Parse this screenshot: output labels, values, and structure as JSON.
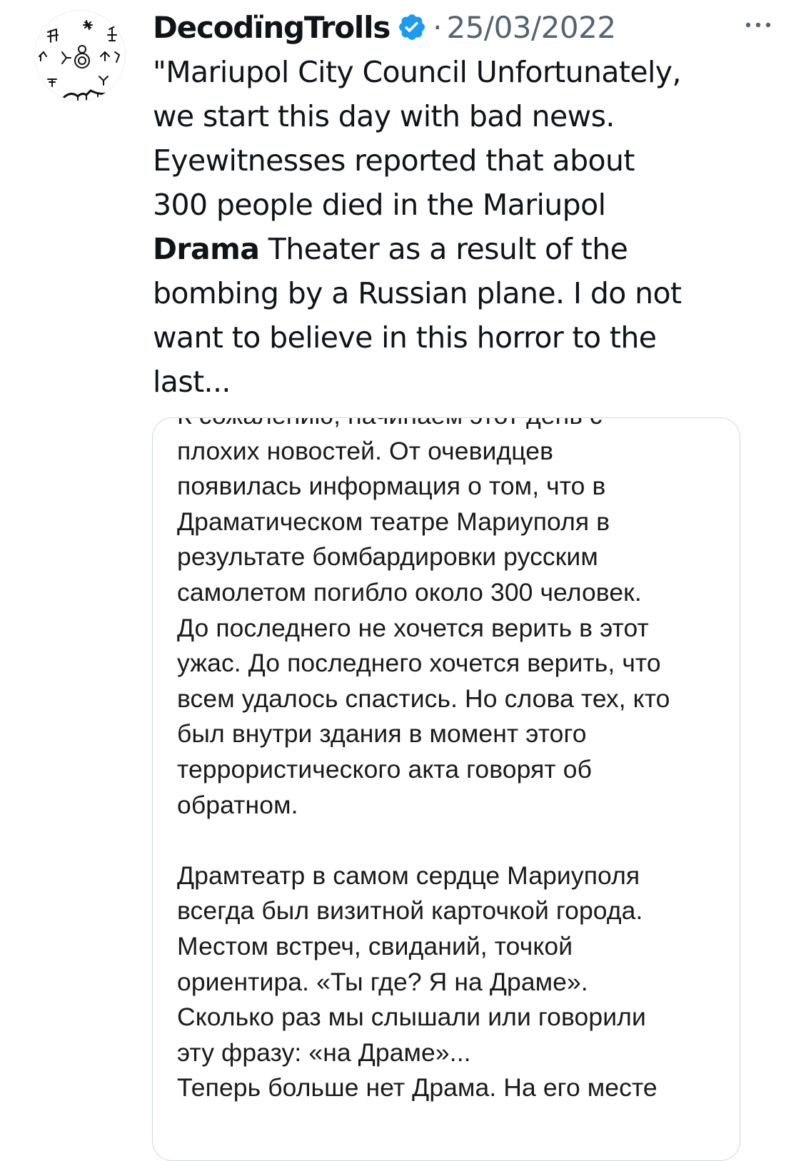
{
  "tweet": {
    "author": {
      "display_name": "DecodïngTrolls",
      "verified": true,
      "avatar_icon": "petroglyph-avatar-icon"
    },
    "separator": "·",
    "date": "25/03/2022",
    "more_icon": "more-options-icon",
    "text_lines": [
      "\"Mariupol City Council Unfortunately,",
      "we start this day with bad news.",
      "Eyewitnesses reported that about",
      "300 people died in the Mariupol",
      "Theater as a result of the",
      "bombing by a Russian plane. I do not",
      "want to believe in this horror to the",
      "last..."
    ],
    "highlight_word": "Drama",
    "media_text": {
      "paragraph1_lines": [
        "К сожалению, начинаем этот день с",
        "плохих новостей. От очевидцев",
        "появилась информация о том, что в",
        "Драматическом театре Мариуполя в",
        "результате бомбардировки русским",
        "самолетом погибло около 300 человек.",
        "До последнего не хочется верить в этот",
        "ужас. До последнего хочется верить, что",
        "всем удалось спастись. Но слова тех, кто",
        "был внутри здания в момент этого",
        "террористического акта говорят об",
        "обратном."
      ],
      "paragraph2_lines": [
        "Драмтеатр в самом сердце Мариуполя",
        "всегда был визитной карточкой города.",
        "Местом встреч, свиданий, точкой",
        "ориентира. «Ты где? Я на Драме».",
        "Сколько раз мы слышали или говорили",
        "эту фразу: «на Драме»...",
        "Теперь больше нет Драма. На его месте"
      ]
    }
  },
  "colors": {
    "text": "#0f1419",
    "secondary": "#536471",
    "verified_blue": "#1d9bf0",
    "border": "#cfd9de"
  }
}
